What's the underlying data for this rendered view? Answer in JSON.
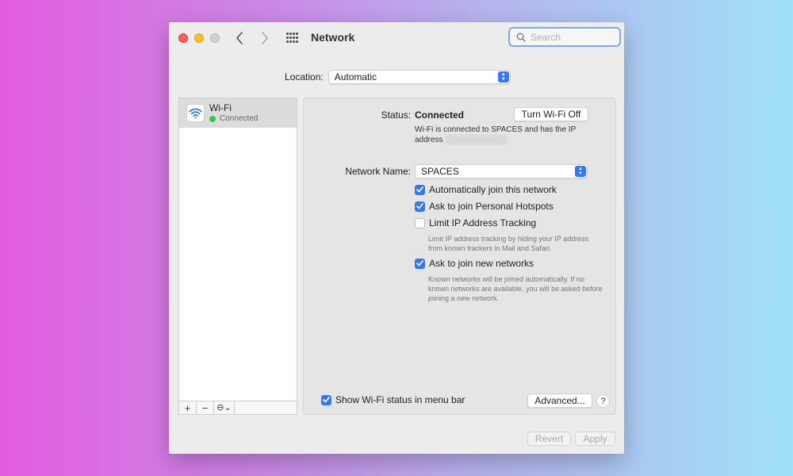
{
  "window": {
    "title": "Network",
    "search_placeholder": "Search"
  },
  "location": {
    "label": "Location:",
    "value": "Automatic"
  },
  "sidebar": {
    "items": [
      {
        "name": "Wi-Fi",
        "status": "Connected",
        "status_color": "#34c84a"
      }
    ],
    "toolbar": {
      "add": "+",
      "remove": "−",
      "action": "⊖⌄"
    }
  },
  "panel": {
    "status_label": "Status:",
    "status_value": "Connected",
    "turn_off_label": "Turn Wi-Fi Off",
    "status_description_1": "Wi-Fi is connected to SPACES and has the IP",
    "status_description_2": "address",
    "network_name_label": "Network Name:",
    "network_name_value": "SPACES",
    "options": [
      {
        "label": "Automatically join this network",
        "checked": true
      },
      {
        "label": "Ask to join Personal Hotspots",
        "checked": true
      },
      {
        "label": "Limit IP Address Tracking",
        "checked": false
      },
      {
        "label": "Ask to join new networks",
        "checked": true
      }
    ],
    "limit_ip_hint": "Limit IP address tracking by hiding your IP address from known trackers in Mail and Safari.",
    "new_networks_hint": "Known networks will be joined automatically. If no known networks are available, you will be asked before joining a new network.",
    "show_status_label": "Show Wi-Fi status in menu bar",
    "show_status_checked": true,
    "advanced_label": "Advanced...",
    "help_label": "?"
  },
  "footer": {
    "revert_label": "Revert",
    "apply_label": "Apply"
  },
  "colors": {
    "accent": "#3478f6",
    "search_focus": "#7fa9e6"
  }
}
